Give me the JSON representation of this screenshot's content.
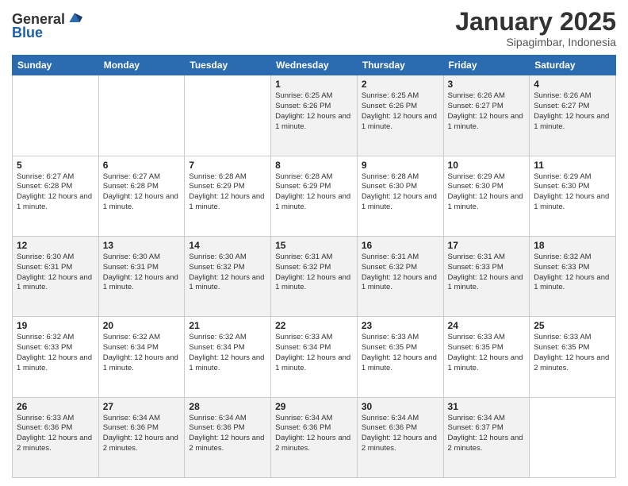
{
  "header": {
    "logo": {
      "line1": "General",
      "line2": "Blue"
    },
    "title": "January 2025",
    "location": "Sipagimbar, Indonesia"
  },
  "weekdays": [
    "Sunday",
    "Monday",
    "Tuesday",
    "Wednesday",
    "Thursday",
    "Friday",
    "Saturday"
  ],
  "weeks": [
    [
      {
        "day": "",
        "info": ""
      },
      {
        "day": "",
        "info": ""
      },
      {
        "day": "",
        "info": ""
      },
      {
        "day": "1",
        "info": "Sunrise: 6:25 AM\nSunset: 6:26 PM\nDaylight: 12 hours and 1 minute."
      },
      {
        "day": "2",
        "info": "Sunrise: 6:25 AM\nSunset: 6:26 PM\nDaylight: 12 hours and 1 minute."
      },
      {
        "day": "3",
        "info": "Sunrise: 6:26 AM\nSunset: 6:27 PM\nDaylight: 12 hours and 1 minute."
      },
      {
        "day": "4",
        "info": "Sunrise: 6:26 AM\nSunset: 6:27 PM\nDaylight: 12 hours and 1 minute."
      }
    ],
    [
      {
        "day": "5",
        "info": "Sunrise: 6:27 AM\nSunset: 6:28 PM\nDaylight: 12 hours and 1 minute."
      },
      {
        "day": "6",
        "info": "Sunrise: 6:27 AM\nSunset: 6:28 PM\nDaylight: 12 hours and 1 minute."
      },
      {
        "day": "7",
        "info": "Sunrise: 6:28 AM\nSunset: 6:29 PM\nDaylight: 12 hours and 1 minute."
      },
      {
        "day": "8",
        "info": "Sunrise: 6:28 AM\nSunset: 6:29 PM\nDaylight: 12 hours and 1 minute."
      },
      {
        "day": "9",
        "info": "Sunrise: 6:28 AM\nSunset: 6:30 PM\nDaylight: 12 hours and 1 minute."
      },
      {
        "day": "10",
        "info": "Sunrise: 6:29 AM\nSunset: 6:30 PM\nDaylight: 12 hours and 1 minute."
      },
      {
        "day": "11",
        "info": "Sunrise: 6:29 AM\nSunset: 6:30 PM\nDaylight: 12 hours and 1 minute."
      }
    ],
    [
      {
        "day": "12",
        "info": "Sunrise: 6:30 AM\nSunset: 6:31 PM\nDaylight: 12 hours and 1 minute."
      },
      {
        "day": "13",
        "info": "Sunrise: 6:30 AM\nSunset: 6:31 PM\nDaylight: 12 hours and 1 minute."
      },
      {
        "day": "14",
        "info": "Sunrise: 6:30 AM\nSunset: 6:32 PM\nDaylight: 12 hours and 1 minute."
      },
      {
        "day": "15",
        "info": "Sunrise: 6:31 AM\nSunset: 6:32 PM\nDaylight: 12 hours and 1 minute."
      },
      {
        "day": "16",
        "info": "Sunrise: 6:31 AM\nSunset: 6:32 PM\nDaylight: 12 hours and 1 minute."
      },
      {
        "day": "17",
        "info": "Sunrise: 6:31 AM\nSunset: 6:33 PM\nDaylight: 12 hours and 1 minute."
      },
      {
        "day": "18",
        "info": "Sunrise: 6:32 AM\nSunset: 6:33 PM\nDaylight: 12 hours and 1 minute."
      }
    ],
    [
      {
        "day": "19",
        "info": "Sunrise: 6:32 AM\nSunset: 6:33 PM\nDaylight: 12 hours and 1 minute."
      },
      {
        "day": "20",
        "info": "Sunrise: 6:32 AM\nSunset: 6:34 PM\nDaylight: 12 hours and 1 minute."
      },
      {
        "day": "21",
        "info": "Sunrise: 6:32 AM\nSunset: 6:34 PM\nDaylight: 12 hours and 1 minute."
      },
      {
        "day": "22",
        "info": "Sunrise: 6:33 AM\nSunset: 6:34 PM\nDaylight: 12 hours and 1 minute."
      },
      {
        "day": "23",
        "info": "Sunrise: 6:33 AM\nSunset: 6:35 PM\nDaylight: 12 hours and 1 minute."
      },
      {
        "day": "24",
        "info": "Sunrise: 6:33 AM\nSunset: 6:35 PM\nDaylight: 12 hours and 1 minute."
      },
      {
        "day": "25",
        "info": "Sunrise: 6:33 AM\nSunset: 6:35 PM\nDaylight: 12 hours and 2 minutes."
      }
    ],
    [
      {
        "day": "26",
        "info": "Sunrise: 6:33 AM\nSunset: 6:36 PM\nDaylight: 12 hours and 2 minutes."
      },
      {
        "day": "27",
        "info": "Sunrise: 6:34 AM\nSunset: 6:36 PM\nDaylight: 12 hours and 2 minutes."
      },
      {
        "day": "28",
        "info": "Sunrise: 6:34 AM\nSunset: 6:36 PM\nDaylight: 12 hours and 2 minutes."
      },
      {
        "day": "29",
        "info": "Sunrise: 6:34 AM\nSunset: 6:36 PM\nDaylight: 12 hours and 2 minutes."
      },
      {
        "day": "30",
        "info": "Sunrise: 6:34 AM\nSunset: 6:36 PM\nDaylight: 12 hours and 2 minutes."
      },
      {
        "day": "31",
        "info": "Sunrise: 6:34 AM\nSunset: 6:37 PM\nDaylight: 12 hours and 2 minutes."
      },
      {
        "day": "",
        "info": ""
      }
    ]
  ]
}
